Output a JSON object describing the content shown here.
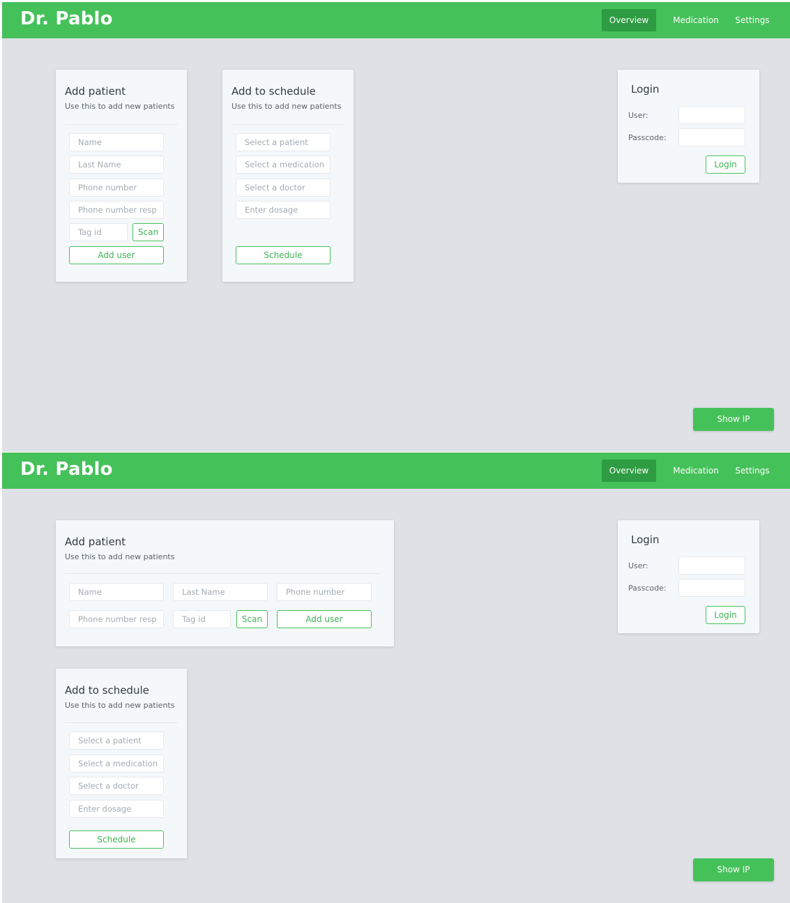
{
  "header": {
    "brand": "Dr. Pablo",
    "nav": [
      {
        "label": "Overview",
        "active": true
      },
      {
        "label": "Medication",
        "active": false
      },
      {
        "label": "Settings",
        "active": false
      }
    ]
  },
  "add_patient": {
    "title": "Add patient",
    "subtitle": "Use this to add new patients",
    "placeholders": {
      "name": "Name",
      "last_name": "Last Name",
      "phone": "Phone number",
      "phone_resp": "Phone number resp",
      "tag_id": "Tag id"
    },
    "scan_label": "Scan",
    "add_user_label": "Add user"
  },
  "schedule": {
    "title": "Add to schedule",
    "subtitle": "Use this to add new patients",
    "placeholders": {
      "patient": "Select  a patient",
      "medication": "Select a medication",
      "doctor": "Select a doctor",
      "dosage": "Enter dosage"
    },
    "schedule_label": "Schedule"
  },
  "login": {
    "title": "Login",
    "user_label": "User:",
    "passcode_label": "Passcode:",
    "user_value": "",
    "passcode_value": "",
    "button_label": "Login"
  },
  "show_ip_label": "Show IP",
  "colors": {
    "brand_green": "#45c15a",
    "active_tab": "#2e9c42",
    "background": "#dfe1e6"
  }
}
